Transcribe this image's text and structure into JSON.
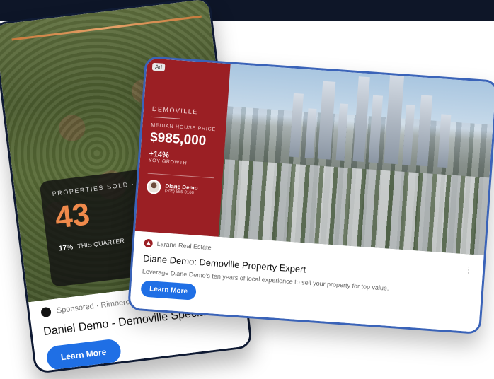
{
  "back_ad": {
    "stat_label": "PROPERTIES SOLD · DEMO",
    "stat_value": "43",
    "stat_change": "17%",
    "stat_period": "THIS QUARTER",
    "sponsor_text": "Sponsored · Rimbero",
    "title": "Daniel Demo - Demoville Specialist",
    "cta_label": "Learn More"
  },
  "front_ad": {
    "ad_badge": "Ad",
    "city": "DEMOVILLE",
    "price_label": "MEDIAN HOUSE PRICE",
    "price": "$985,000",
    "growth": "+14%",
    "growth_label": "YOY GROWTH",
    "agent_name": "Diane Demo",
    "agent_phone": "(305) 555-0166",
    "brand_name": "Larana Real Estate",
    "title": "Diane Demo: Demoville Property Expert",
    "description": "Leverage Diane Demo's ten years of local experience to sell your property for top value.",
    "cta_label": "Learn More",
    "menu_icon": "⋮"
  },
  "colors": {
    "accent_blue": "#1f6fe5",
    "panel_red": "#9b1f24",
    "stat_orange": "#f08a4b",
    "top_band": "#0e1628"
  }
}
